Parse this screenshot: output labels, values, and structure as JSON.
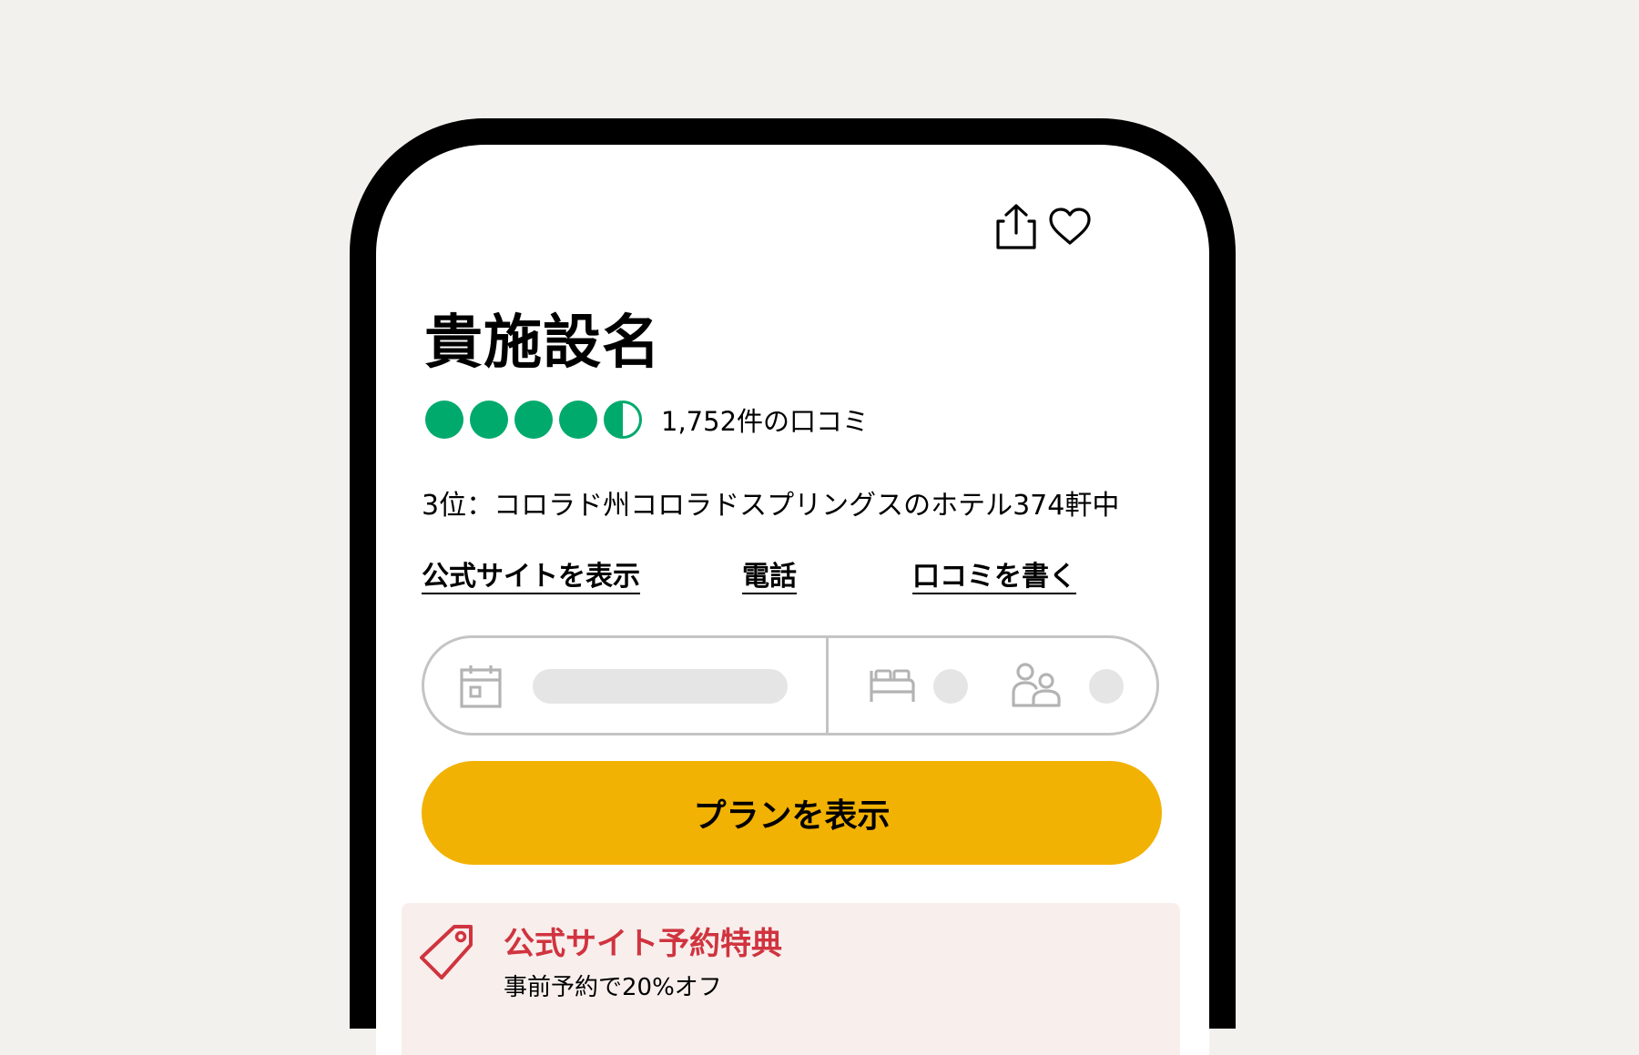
{
  "header": {
    "share_icon": "share-icon",
    "favorite_icon": "heart-icon"
  },
  "property": {
    "name": "貴施設名",
    "rating": 4.5,
    "rating_max": 5,
    "review_count_label": "1,752件の口コミ",
    "ranking": "3位：コロラド州コロラドスプリングスのホテル374軒中"
  },
  "links": {
    "website": "公式サイトを表示",
    "phone": "電話",
    "write_review": "口コミを書く"
  },
  "search": {
    "date_icon": "calendar-icon",
    "rooms_icon": "bed-icon",
    "guests_icon": "guests-icon"
  },
  "cta": {
    "label": "プランを表示"
  },
  "promo": {
    "icon": "price-tag-icon",
    "title": "公式サイト予約特典",
    "subtitle": "事前予約で20%オフ"
  },
  "colors": {
    "background": "#f2f1ed",
    "rating_green": "#00aa6c",
    "cta_yellow": "#f2b203",
    "promo_red": "#d0343f",
    "promo_background": "#f8efed",
    "field_border": "#c4c4c4",
    "placeholder_gray": "#e5e5e5"
  }
}
